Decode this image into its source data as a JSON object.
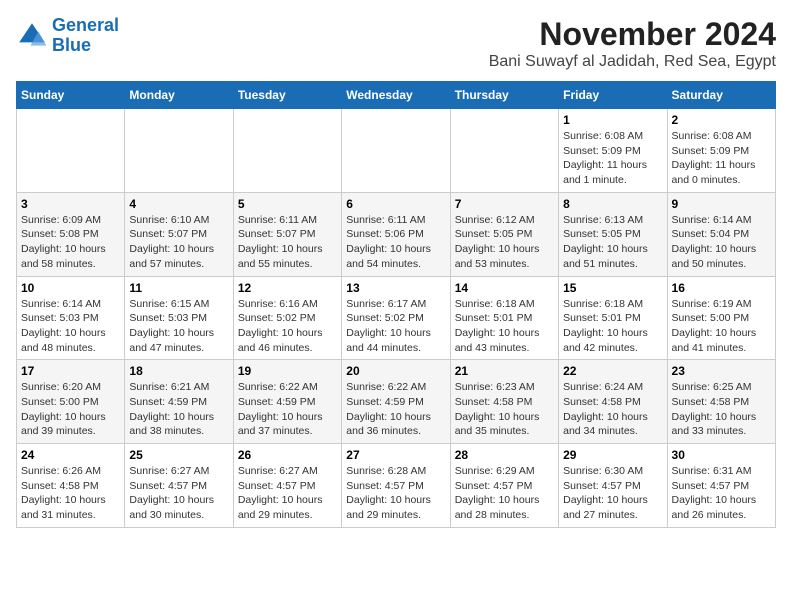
{
  "logo": {
    "line1": "General",
    "line2": "Blue"
  },
  "title": "November 2024",
  "subtitle": "Bani Suwayf al Jadidah, Red Sea, Egypt",
  "weekdays": [
    "Sunday",
    "Monday",
    "Tuesday",
    "Wednesday",
    "Thursday",
    "Friday",
    "Saturday"
  ],
  "weeks": [
    [
      {
        "day": "",
        "info": ""
      },
      {
        "day": "",
        "info": ""
      },
      {
        "day": "",
        "info": ""
      },
      {
        "day": "",
        "info": ""
      },
      {
        "day": "",
        "info": ""
      },
      {
        "day": "1",
        "info": "Sunrise: 6:08 AM\nSunset: 5:09 PM\nDaylight: 11 hours\nand 1 minute."
      },
      {
        "day": "2",
        "info": "Sunrise: 6:08 AM\nSunset: 5:09 PM\nDaylight: 11 hours\nand 0 minutes."
      }
    ],
    [
      {
        "day": "3",
        "info": "Sunrise: 6:09 AM\nSunset: 5:08 PM\nDaylight: 10 hours\nand 58 minutes."
      },
      {
        "day": "4",
        "info": "Sunrise: 6:10 AM\nSunset: 5:07 PM\nDaylight: 10 hours\nand 57 minutes."
      },
      {
        "day": "5",
        "info": "Sunrise: 6:11 AM\nSunset: 5:07 PM\nDaylight: 10 hours\nand 55 minutes."
      },
      {
        "day": "6",
        "info": "Sunrise: 6:11 AM\nSunset: 5:06 PM\nDaylight: 10 hours\nand 54 minutes."
      },
      {
        "day": "7",
        "info": "Sunrise: 6:12 AM\nSunset: 5:05 PM\nDaylight: 10 hours\nand 53 minutes."
      },
      {
        "day": "8",
        "info": "Sunrise: 6:13 AM\nSunset: 5:05 PM\nDaylight: 10 hours\nand 51 minutes."
      },
      {
        "day": "9",
        "info": "Sunrise: 6:14 AM\nSunset: 5:04 PM\nDaylight: 10 hours\nand 50 minutes."
      }
    ],
    [
      {
        "day": "10",
        "info": "Sunrise: 6:14 AM\nSunset: 5:03 PM\nDaylight: 10 hours\nand 48 minutes."
      },
      {
        "day": "11",
        "info": "Sunrise: 6:15 AM\nSunset: 5:03 PM\nDaylight: 10 hours\nand 47 minutes."
      },
      {
        "day": "12",
        "info": "Sunrise: 6:16 AM\nSunset: 5:02 PM\nDaylight: 10 hours\nand 46 minutes."
      },
      {
        "day": "13",
        "info": "Sunrise: 6:17 AM\nSunset: 5:02 PM\nDaylight: 10 hours\nand 44 minutes."
      },
      {
        "day": "14",
        "info": "Sunrise: 6:18 AM\nSunset: 5:01 PM\nDaylight: 10 hours\nand 43 minutes."
      },
      {
        "day": "15",
        "info": "Sunrise: 6:18 AM\nSunset: 5:01 PM\nDaylight: 10 hours\nand 42 minutes."
      },
      {
        "day": "16",
        "info": "Sunrise: 6:19 AM\nSunset: 5:00 PM\nDaylight: 10 hours\nand 41 minutes."
      }
    ],
    [
      {
        "day": "17",
        "info": "Sunrise: 6:20 AM\nSunset: 5:00 PM\nDaylight: 10 hours\nand 39 minutes."
      },
      {
        "day": "18",
        "info": "Sunrise: 6:21 AM\nSunset: 4:59 PM\nDaylight: 10 hours\nand 38 minutes."
      },
      {
        "day": "19",
        "info": "Sunrise: 6:22 AM\nSunset: 4:59 PM\nDaylight: 10 hours\nand 37 minutes."
      },
      {
        "day": "20",
        "info": "Sunrise: 6:22 AM\nSunset: 4:59 PM\nDaylight: 10 hours\nand 36 minutes."
      },
      {
        "day": "21",
        "info": "Sunrise: 6:23 AM\nSunset: 4:58 PM\nDaylight: 10 hours\nand 35 minutes."
      },
      {
        "day": "22",
        "info": "Sunrise: 6:24 AM\nSunset: 4:58 PM\nDaylight: 10 hours\nand 34 minutes."
      },
      {
        "day": "23",
        "info": "Sunrise: 6:25 AM\nSunset: 4:58 PM\nDaylight: 10 hours\nand 33 minutes."
      }
    ],
    [
      {
        "day": "24",
        "info": "Sunrise: 6:26 AM\nSunset: 4:58 PM\nDaylight: 10 hours\nand 31 minutes."
      },
      {
        "day": "25",
        "info": "Sunrise: 6:27 AM\nSunset: 4:57 PM\nDaylight: 10 hours\nand 30 minutes."
      },
      {
        "day": "26",
        "info": "Sunrise: 6:27 AM\nSunset: 4:57 PM\nDaylight: 10 hours\nand 29 minutes."
      },
      {
        "day": "27",
        "info": "Sunrise: 6:28 AM\nSunset: 4:57 PM\nDaylight: 10 hours\nand 29 minutes."
      },
      {
        "day": "28",
        "info": "Sunrise: 6:29 AM\nSunset: 4:57 PM\nDaylight: 10 hours\nand 28 minutes."
      },
      {
        "day": "29",
        "info": "Sunrise: 6:30 AM\nSunset: 4:57 PM\nDaylight: 10 hours\nand 27 minutes."
      },
      {
        "day": "30",
        "info": "Sunrise: 6:31 AM\nSunset: 4:57 PM\nDaylight: 10 hours\nand 26 minutes."
      }
    ]
  ]
}
